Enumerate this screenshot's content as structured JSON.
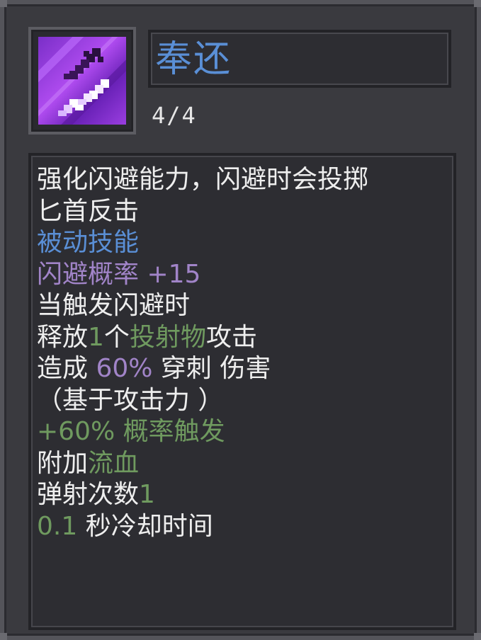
{
  "skill": {
    "name": "奉还",
    "level": "4/4",
    "icon": "purple-dagger-skill-icon"
  },
  "colors": {
    "title": "#5a8fd6",
    "text": "#eeeeee",
    "passive": "#5a8fd6",
    "stat": "#a184c8",
    "highlight": "#6f9a5f",
    "panel": "#2d2d32",
    "frame": "#3a3a3f"
  },
  "description": {
    "line1": "强化闪避能力，闪避时会投掷",
    "line2": "匕首反击",
    "type": "被动技能",
    "stat": {
      "label": "闪避概率",
      "value": "+15"
    },
    "trigger": "当触发闪避时",
    "release": {
      "pre": "释放",
      "count": "1",
      "mid": "个",
      "projectile": "投射物",
      "post": "攻击"
    },
    "damage": {
      "pre": "造成 ",
      "percent": "60%",
      "post": " 穿刺 伤害"
    },
    "basis": "（基于攻击力 ）",
    "chance": "+60% 概率触发",
    "extra": {
      "pre": "附加",
      "effect": "流血"
    },
    "bounce": {
      "label": "弹射次数",
      "value": "1"
    },
    "cooldown": {
      "value": "0.1",
      "label": " 秒冷却时间"
    }
  }
}
